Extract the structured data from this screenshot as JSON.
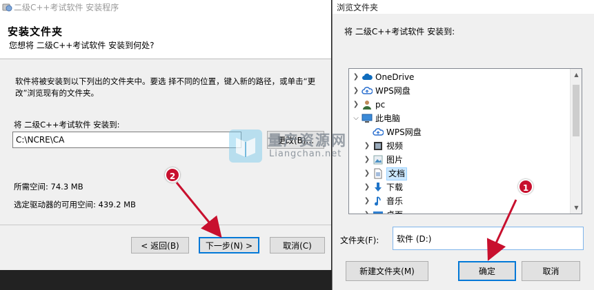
{
  "installer": {
    "title": "二级C++考试软件 安装程序",
    "header_title": "安装文件夹",
    "header_subtitle": "您想将 二级C++考试软件 安装到何处?",
    "description": "软件将被安装到以下列出的文件夹中。要选   择不同的位置，键入新的路径，或单击“更  改”浏览现有的文件夹。",
    "install_to_label": "将 二级C++考试软件 安装到:",
    "path_value": "C:\\NCRE\\CA",
    "browse_button": "更改(B)...",
    "space_required": "所需空间: 74.3 MB",
    "space_available": "选定驱动器的可用空间: 439.2 MB",
    "back_button": "< 返回(B)",
    "next_button": "下一步(N) >",
    "cancel_button": "取消(C)"
  },
  "dialog": {
    "title": "浏览文件夹",
    "prompt": "将 二级C++考试软件 安装到:",
    "tree": [
      {
        "label": "OneDrive",
        "icon": "cloud-icon"
      },
      {
        "label": "WPS网盘",
        "icon": "wps-cloud-icon"
      },
      {
        "label": "pc",
        "icon": "user-icon"
      },
      {
        "label": "此电脑",
        "icon": "computer-icon"
      },
      {
        "label": "WPS网盘",
        "icon": "wps-cloud-icon"
      },
      {
        "label": "视频",
        "icon": "video-folder-icon"
      },
      {
        "label": "图片",
        "icon": "pictures-folder-icon"
      },
      {
        "label": "文档",
        "icon": "documents-folder-icon"
      },
      {
        "label": "下载",
        "icon": "download-icon"
      },
      {
        "label": "音乐",
        "icon": "music-icon"
      },
      {
        "label": "桌面",
        "icon": "desktop-folder-icon"
      }
    ],
    "folder_label": "文件夹(F):",
    "folder_value": "软件 (D:)",
    "new_folder_button": "新建文件夹(M)",
    "ok_button": "确定",
    "cancel_button": "取消"
  },
  "watermark": {
    "title": "量产资源网",
    "subtitle": "Liangchan.net"
  },
  "annotations": {
    "badge_1": "1",
    "badge_2": "2",
    "color": "#c8102e"
  }
}
